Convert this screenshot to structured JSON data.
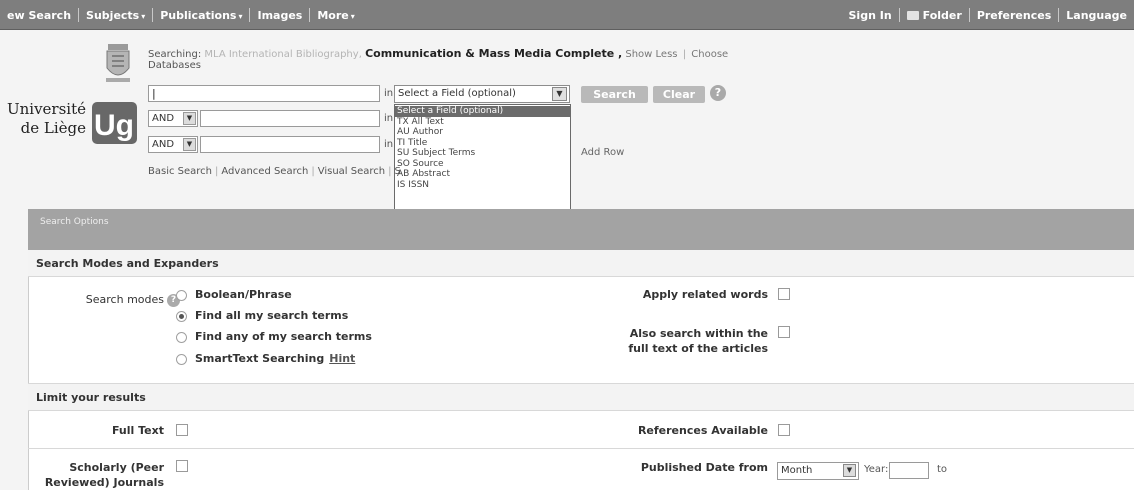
{
  "topnav": {
    "left": [
      {
        "label": "ew Search",
        "caret": false
      },
      {
        "label": "Subjects",
        "caret": true
      },
      {
        "label": "Publications",
        "caret": true
      },
      {
        "label": "Images",
        "caret": false
      },
      {
        "label": "More",
        "caret": true
      }
    ],
    "right": {
      "sign_in": "Sign In",
      "folder": "Folder",
      "preferences": "Preferences",
      "languages": "Language"
    },
    "caret_glyph": "▾"
  },
  "logo": {
    "line1": "Université",
    "line2": "de Liège",
    "mark": "Ug"
  },
  "searching": {
    "prefix": "Searching:",
    "db1": "MLA International Bibliography,",
    "db2": "Communication & Mass Media Complete ,",
    "show_less": "Show Less",
    "choose": "Choose",
    "databases": "Databases"
  },
  "search_rows": {
    "in_label": "in",
    "row1_value": "|",
    "op2": "AND",
    "op3": "AND",
    "field_select": "Select a Field (optional)"
  },
  "field_options": [
    "Select a Field (optional)",
    "TX All Text",
    "AU Author",
    "TI Title",
    "SU Subject Terms",
    "SO Source",
    "AB Abstract",
    "IS ISSN"
  ],
  "buttons": {
    "search": "Search",
    "clear": "Clear",
    "help": "?",
    "add_row": "Add Row"
  },
  "search_links": {
    "basic": "Basic Search",
    "advanced": "Advanced Search",
    "visual": "Visual Search",
    "more": "S"
  },
  "options": {
    "header": "Search Options",
    "modes_section": "Search Modes and Expanders",
    "search_modes_label": "Search modes",
    "modes": [
      {
        "label": "Boolean/Phrase",
        "selected": false
      },
      {
        "label": "Find all my search terms",
        "selected": true
      },
      {
        "label": "Find any of my search terms",
        "selected": false
      },
      {
        "label": "SmartText Searching",
        "selected": false
      }
    ],
    "hint": "Hint",
    "apply_related": "Apply related words",
    "also_search_1": "Also search within the",
    "also_search_2": "full text of the articles",
    "limit_section": "Limit your results",
    "full_text": "Full Text",
    "references": "References Available",
    "scholarly_1": "Scholarly (Peer",
    "scholarly_2": "Reviewed) Journals",
    "published_date": "Published Date from",
    "month": "Month",
    "year_label": "Year:",
    "to_label": "to"
  }
}
